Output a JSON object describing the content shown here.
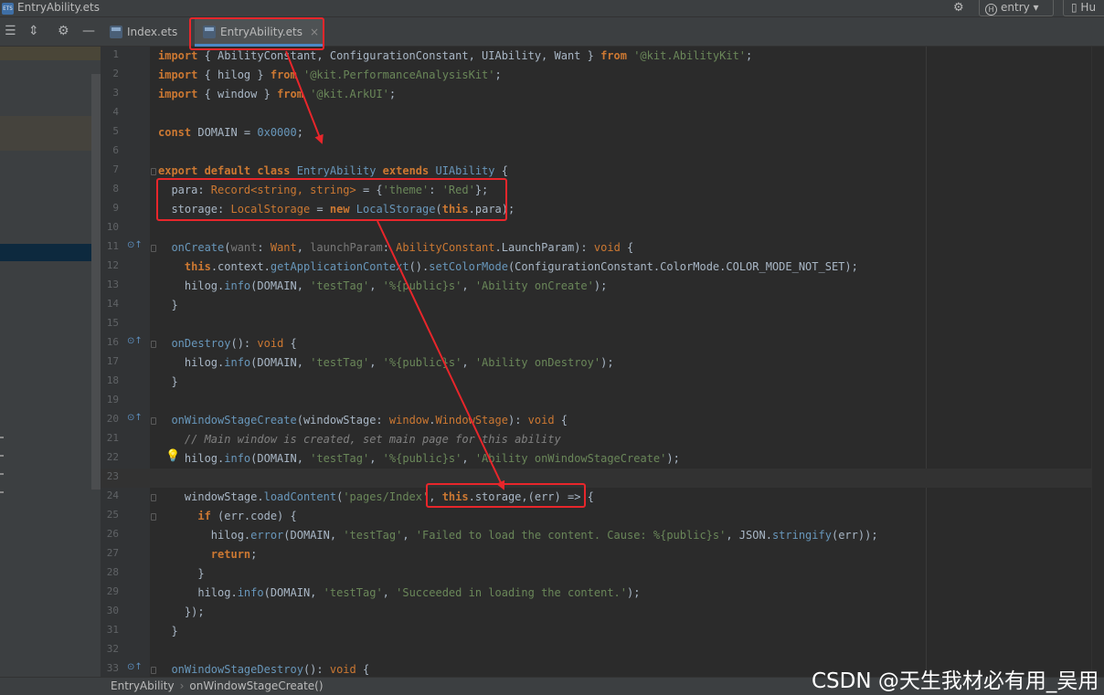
{
  "window": {
    "title": "EntryAbility.ets",
    "app_icon_label": "ETS",
    "run_config": "entry",
    "run_config_icon": "H",
    "device_label": "Hu"
  },
  "icons": {
    "app": "ets-file-icon",
    "settings": "gear-icon",
    "collapse_all": "collapse-all-icon",
    "expand_all": "expand-all-icon",
    "options": "gear-icon",
    "hide": "minus-icon",
    "override": "override-method-icon",
    "intention": "lightbulb-icon"
  },
  "tabs": [
    {
      "label": "Index.ets",
      "icon_label": "ETS",
      "active": false
    },
    {
      "label": "EntryAbility.ets",
      "icon_label": "ETS",
      "active": true,
      "close": "×"
    }
  ],
  "editor": {
    "lines": [
      {
        "n": "1",
        "tokens": [
          [
            "kw",
            "import"
          ],
          [
            "d",
            " { AbilityConstant, ConfigurationConstant, UIAbility, Want } "
          ],
          [
            "kw",
            "from"
          ],
          [
            "d",
            " "
          ],
          [
            "s",
            "'@kit.AbilityKit'"
          ],
          [
            "d",
            ";"
          ]
        ]
      },
      {
        "n": "2",
        "tokens": [
          [
            "kw",
            "import"
          ],
          [
            "d",
            " { hilog } "
          ],
          [
            "kw",
            "from"
          ],
          [
            "d",
            " "
          ],
          [
            "s",
            "'@kit.PerformanceAnalysisKit'"
          ],
          [
            "d",
            ";"
          ]
        ]
      },
      {
        "n": "3",
        "tokens": [
          [
            "kw",
            "import"
          ],
          [
            "d",
            " { window } "
          ],
          [
            "kw",
            "from"
          ],
          [
            "d",
            " "
          ],
          [
            "s",
            "'@kit.ArkUI'"
          ],
          [
            "d",
            ";"
          ]
        ]
      },
      {
        "n": "4",
        "tokens": []
      },
      {
        "n": "5",
        "tokens": [
          [
            "kw",
            "const"
          ],
          [
            "d",
            " DOMAIN = "
          ],
          [
            "n",
            "0x0000"
          ],
          [
            "d",
            ";"
          ]
        ]
      },
      {
        "n": "6",
        "tokens": []
      },
      {
        "n": "7",
        "tokens": [
          [
            "kw",
            "export default class"
          ],
          [
            "d",
            " "
          ],
          [
            "t",
            "EntryAbility"
          ],
          [
            "d",
            " "
          ],
          [
            "kw",
            "extends"
          ],
          [
            "d",
            " "
          ],
          [
            "t",
            "UIAbility"
          ],
          [
            "d",
            " {"
          ]
        ]
      },
      {
        "n": "8",
        "tokens": [
          [
            "d",
            "  para: "
          ],
          [
            "k",
            "Record<string, string>"
          ],
          [
            "d",
            " = {"
          ],
          [
            "s",
            "'theme'"
          ],
          [
            "d",
            ": "
          ],
          [
            "s",
            "'Red'"
          ],
          [
            "d",
            "};"
          ]
        ]
      },
      {
        "n": "9",
        "tokens": [
          [
            "d",
            "  storage: "
          ],
          [
            "k",
            "LocalStorage"
          ],
          [
            "d",
            " = "
          ],
          [
            "kw",
            "new"
          ],
          [
            "d",
            " "
          ],
          [
            "t",
            "LocalStorage"
          ],
          [
            "d",
            "("
          ],
          [
            "kw",
            "this"
          ],
          [
            "d",
            ".para);"
          ]
        ]
      },
      {
        "n": "10",
        "tokens": []
      },
      {
        "n": "11",
        "icon": "⊙↑",
        "tokens": [
          [
            "d",
            "  "
          ],
          [
            "t",
            "onCreate"
          ],
          [
            "d",
            "("
          ],
          [
            "gray",
            "want"
          ],
          [
            "d",
            ": "
          ],
          [
            "k",
            "Want"
          ],
          [
            "d",
            ", "
          ],
          [
            "gray",
            "launchParam"
          ],
          [
            "d",
            ": "
          ],
          [
            "k",
            "AbilityConstant"
          ],
          [
            "d",
            ".LaunchParam): "
          ],
          [
            "k",
            "void"
          ],
          [
            "d",
            " {"
          ]
        ]
      },
      {
        "n": "12",
        "tokens": [
          [
            "d",
            "    "
          ],
          [
            "kw",
            "this"
          ],
          [
            "d",
            ".context."
          ],
          [
            "t",
            "getApplicationContext"
          ],
          [
            "d",
            "()."
          ],
          [
            "t",
            "setColorMode"
          ],
          [
            "d",
            "(ConfigurationConstant.ColorMode.COLOR_MODE_NOT_SET);"
          ]
        ]
      },
      {
        "n": "13",
        "tokens": [
          [
            "d",
            "    hilog."
          ],
          [
            "t",
            "info"
          ],
          [
            "d",
            "(DOMAIN, "
          ],
          [
            "s",
            "'testTag'"
          ],
          [
            "d",
            ", "
          ],
          [
            "s",
            "'%{public}s'"
          ],
          [
            "d",
            ", "
          ],
          [
            "s",
            "'Ability onCreate'"
          ],
          [
            "d",
            ");"
          ]
        ]
      },
      {
        "n": "14",
        "tokens": [
          [
            "d",
            "  }"
          ]
        ]
      },
      {
        "n": "15",
        "tokens": []
      },
      {
        "n": "16",
        "icon": "⊙↑",
        "tokens": [
          [
            "d",
            "  "
          ],
          [
            "t",
            "onDestroy"
          ],
          [
            "d",
            "(): "
          ],
          [
            "k",
            "void"
          ],
          [
            "d",
            " {"
          ]
        ]
      },
      {
        "n": "17",
        "tokens": [
          [
            "d",
            "    hilog."
          ],
          [
            "t",
            "info"
          ],
          [
            "d",
            "(DOMAIN, "
          ],
          [
            "s",
            "'testTag'"
          ],
          [
            "d",
            ", "
          ],
          [
            "s",
            "'%{public}s'"
          ],
          [
            "d",
            ", "
          ],
          [
            "s",
            "'Ability onDestroy'"
          ],
          [
            "d",
            ");"
          ]
        ]
      },
      {
        "n": "18",
        "tokens": [
          [
            "d",
            "  }"
          ]
        ]
      },
      {
        "n": "19",
        "tokens": []
      },
      {
        "n": "20",
        "icon": "⊙↑",
        "tokens": [
          [
            "d",
            "  "
          ],
          [
            "t",
            "onWindowStageCreate"
          ],
          [
            "d",
            "(windowStage: "
          ],
          [
            "k",
            "window"
          ],
          [
            "d",
            "."
          ],
          [
            "k",
            "WindowStage"
          ],
          [
            "d",
            "): "
          ],
          [
            "k",
            "void"
          ],
          [
            "d",
            " {"
          ]
        ]
      },
      {
        "n": "21",
        "tokens": [
          [
            "c",
            "    // Main window is created, set main page for this ability"
          ]
        ]
      },
      {
        "n": "22",
        "bulb": true,
        "tokens": [
          [
            "d",
            "    hilog."
          ],
          [
            "t",
            "info"
          ],
          [
            "d",
            "(DOMAIN, "
          ],
          [
            "s",
            "'testTag'"
          ],
          [
            "d",
            ", "
          ],
          [
            "s",
            "'%{public}s'"
          ],
          [
            "d",
            ", "
          ],
          [
            "s",
            "'Ability onWindowStageCreate'"
          ],
          [
            "d",
            ");"
          ]
        ]
      },
      {
        "n": "23",
        "current": true,
        "tokens": []
      },
      {
        "n": "24",
        "tokens": [
          [
            "d",
            "    windowStage."
          ],
          [
            "t",
            "loadContent"
          ],
          [
            "d",
            "("
          ],
          [
            "s",
            "'pages/Index'"
          ],
          [
            "d",
            ", "
          ],
          [
            "kw",
            "this"
          ],
          [
            "d",
            ".storage,(err) => {"
          ]
        ]
      },
      {
        "n": "25",
        "tokens": [
          [
            "d",
            "      "
          ],
          [
            "kw",
            "if"
          ],
          [
            "d",
            " (err.code) {"
          ]
        ]
      },
      {
        "n": "26",
        "tokens": [
          [
            "d",
            "        hilog."
          ],
          [
            "t",
            "error"
          ],
          [
            "d",
            "(DOMAIN, "
          ],
          [
            "s",
            "'testTag'"
          ],
          [
            "d",
            ", "
          ],
          [
            "s",
            "'Failed to load the content. Cause: %{public}s'"
          ],
          [
            "d",
            ", JSON."
          ],
          [
            "t",
            "stringify"
          ],
          [
            "d",
            "(err));"
          ]
        ]
      },
      {
        "n": "27",
        "tokens": [
          [
            "d",
            "        "
          ],
          [
            "kw",
            "return"
          ],
          [
            "d",
            ";"
          ]
        ]
      },
      {
        "n": "28",
        "tokens": [
          [
            "d",
            "      }"
          ]
        ]
      },
      {
        "n": "29",
        "tokens": [
          [
            "d",
            "      hilog."
          ],
          [
            "t",
            "info"
          ],
          [
            "d",
            "(DOMAIN, "
          ],
          [
            "s",
            "'testTag'"
          ],
          [
            "d",
            ", "
          ],
          [
            "s",
            "'Succeeded in loading the content.'"
          ],
          [
            "d",
            ");"
          ]
        ]
      },
      {
        "n": "30",
        "tokens": [
          [
            "d",
            "    });"
          ]
        ]
      },
      {
        "n": "31",
        "tokens": [
          [
            "d",
            "  }"
          ]
        ]
      },
      {
        "n": "32",
        "tokens": []
      },
      {
        "n": "33",
        "icon": "⊙↑",
        "tokens": [
          [
            "d",
            "  "
          ],
          [
            "t",
            "onWindowStageDestroy"
          ],
          [
            "d",
            "(): "
          ],
          [
            "k",
            "void"
          ],
          [
            "d",
            " {"
          ]
        ]
      }
    ]
  },
  "breadcrumb": {
    "items": [
      "EntryAbility",
      "onWindowStageCreate()"
    ],
    "separator": "›"
  },
  "watermark": "CSDN @天生我材必有用_吴用",
  "colors": {
    "annotation": "#e8262b",
    "accent": "#4a88c7"
  }
}
